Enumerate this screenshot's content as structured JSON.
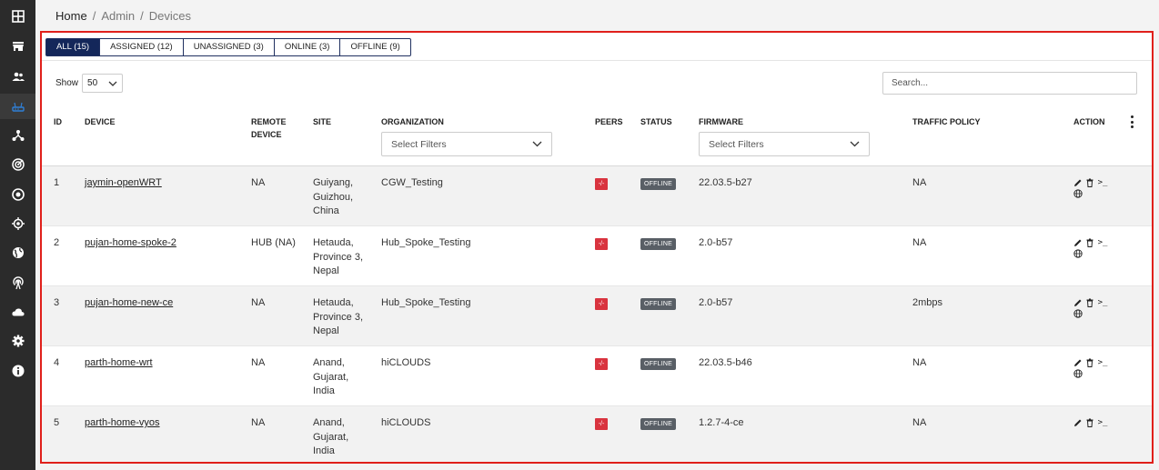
{
  "breadcrumb": {
    "home": "Home",
    "sep1": "/",
    "admin": "Admin",
    "sep2": "/",
    "current": "Devices"
  },
  "tabs": [
    {
      "label": "ALL (15)",
      "active": true
    },
    {
      "label": "ASSIGNED (12)"
    },
    {
      "label": "UNASSIGNED (3)"
    },
    {
      "label": "ONLINE (3)"
    },
    {
      "label": "OFFLINE (9)"
    }
  ],
  "show": {
    "label": "Show",
    "value": "50"
  },
  "search": {
    "placeholder": "Search..."
  },
  "columns": {
    "id": "ID",
    "device": "DEVICE",
    "remote_line1": "REMOTE",
    "remote_line2": "DEVICE",
    "site": "SITE",
    "organization": "ORGANIZATION",
    "peers": "PEERS",
    "status": "STATUS",
    "firmware": "FIRMWARE",
    "traffic_policy": "TRAFFIC POLICY",
    "action": "ACTION"
  },
  "filters": {
    "organization": "Select Filters",
    "firmware": "Select Filters"
  },
  "rows": [
    {
      "id": "1",
      "device": "jaymin-openWRT",
      "remote": "NA",
      "site1": "Guiyang,",
      "site2": "Guizhou,",
      "site3": "China",
      "org": "CGW_Testing",
      "peers": "-/-",
      "status": "OFFLINE",
      "firmware": "22.03.5-b27",
      "policy": "NA",
      "term": ">_"
    },
    {
      "id": "2",
      "device": "pujan-home-spoke-2",
      "remote": "HUB (NA)",
      "site1": "Hetauda,",
      "site2": "Province 3,",
      "site3": "Nepal",
      "org": "Hub_Spoke_Testing",
      "peers": "-/-",
      "status": "OFFLINE",
      "firmware": "2.0-b57",
      "policy": "NA",
      "term": ">_"
    },
    {
      "id": "3",
      "device": "pujan-home-new-ce",
      "remote": "NA",
      "site1": "Hetauda,",
      "site2": "Province 3,",
      "site3": "Nepal",
      "org": "Hub_Spoke_Testing",
      "peers": "-/-",
      "status": "OFFLINE",
      "firmware": "2.0-b57",
      "policy": "2mbps",
      "term": ">_"
    },
    {
      "id": "4",
      "device": "parth-home-wrt",
      "remote": "NA",
      "site1": "Anand,",
      "site2": "Gujarat,",
      "site3": "India",
      "org": "hiCLOUDS",
      "peers": "-/-",
      "status": "OFFLINE",
      "firmware": "22.03.5-b46",
      "policy": "NA",
      "term": ">_"
    },
    {
      "id": "5",
      "device": "parth-home-vyos",
      "remote": "NA",
      "site1": "Anand,",
      "site2": "Gujarat,",
      "site3": "India",
      "org": "hiCLOUDS",
      "peers": "-/-",
      "status": "OFFLINE",
      "firmware": "1.2.7-4-ce",
      "policy": "NA",
      "term": ">_"
    }
  ],
  "sidebar": {
    "items": [
      {
        "icon": "dashboard-icon"
      },
      {
        "icon": "store-icon"
      },
      {
        "icon": "users-icon"
      },
      {
        "icon": "router-icon",
        "active": true
      },
      {
        "icon": "network-icon"
      },
      {
        "icon": "radar-icon"
      },
      {
        "icon": "target-icon"
      },
      {
        "icon": "location-icon"
      },
      {
        "icon": "globe-icon"
      },
      {
        "icon": "antenna-icon"
      },
      {
        "icon": "cloud-icon"
      },
      {
        "icon": "gear-icon"
      },
      {
        "icon": "info-icon"
      }
    ]
  },
  "colors": {
    "accent": "#14275a",
    "highlight": "#e0201b",
    "peers": "#d9343f",
    "status": "#595f66",
    "router_icon": "#2f7fd6"
  }
}
